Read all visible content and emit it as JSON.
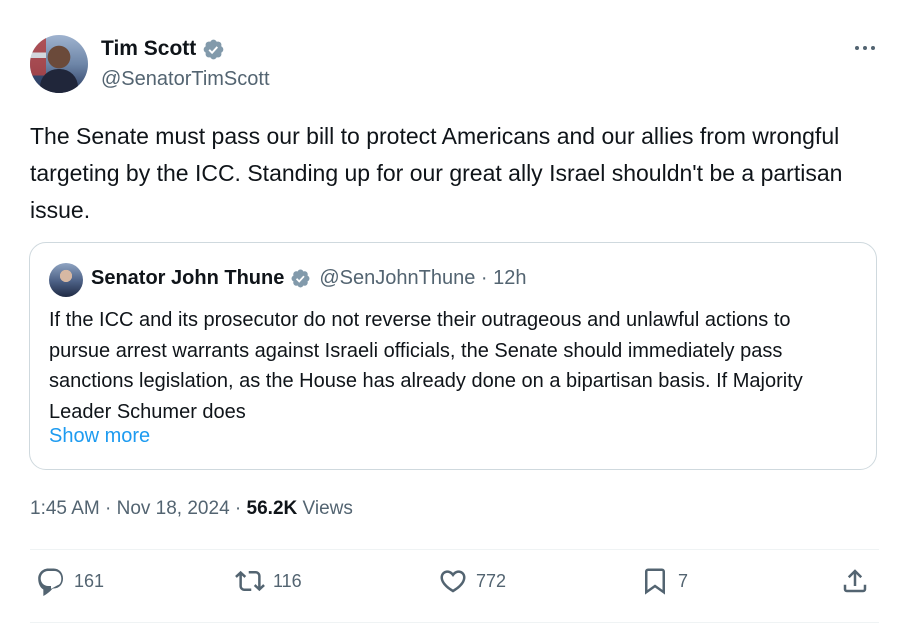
{
  "author": {
    "name": "Tim Scott",
    "handle": "@SenatorTimScott"
  },
  "post": {
    "text": "The Senate must pass our bill to protect Americans and our allies from wrongful targeting by the ICC. Standing up for our great ally Israel shouldn't be a partisan issue.",
    "time": "1:45 AM",
    "date": "Nov 18, 2024",
    "views_count": "56.2K",
    "views_label": "Views"
  },
  "quoted": {
    "name": "Senator John Thune",
    "handle_time": "@SenJohnThune · 12h",
    "text": "If the ICC and its prosecutor do not reverse their outrageous and unlawful actions to pursue arrest warrants against Israeli officials, the Senate should immediately pass sanctions legislation, as the House has already done on a bipartisan basis. If Majority Leader Schumer does",
    "show_more": "Show more"
  },
  "actions": {
    "replies": "161",
    "reposts": "116",
    "likes": "772",
    "bookmarks": "7"
  },
  "colors": {
    "text": "#0f1419",
    "secondary": "#536471",
    "link": "#1d9bf0",
    "verified_badge": "#829aab",
    "border": "#cfd9de"
  },
  "icons": [
    "verified-badge-icon",
    "more-options-icon",
    "reply-icon",
    "repost-icon",
    "like-icon",
    "bookmark-icon",
    "share-icon"
  ]
}
